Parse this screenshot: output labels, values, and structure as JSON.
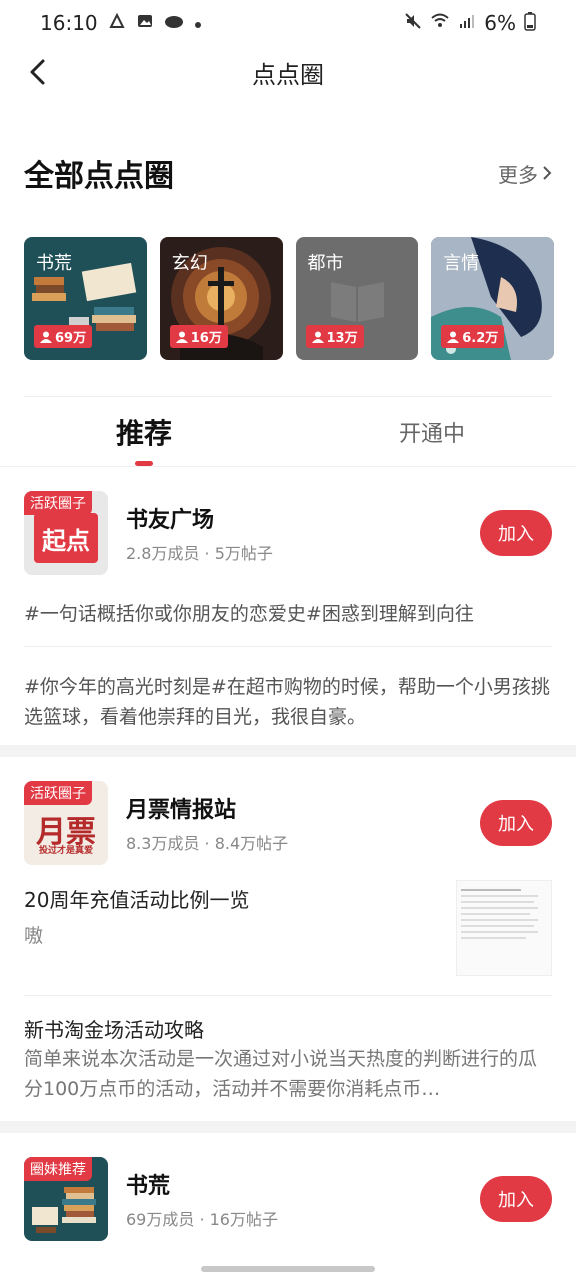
{
  "status": {
    "time": "16:10",
    "battery": "6%"
  },
  "nav": {
    "title": "点点圈"
  },
  "section": {
    "title": "全部点点圈",
    "more_label": "更多"
  },
  "categories": [
    {
      "name": "书荒",
      "members": "69万"
    },
    {
      "name": "玄幻",
      "members": "16万"
    },
    {
      "name": "都市",
      "members": "13万"
    },
    {
      "name": "言情",
      "members": "6.2万"
    }
  ],
  "tabs": [
    {
      "label": "推荐"
    },
    {
      "label": "开通中"
    }
  ],
  "circles": [
    {
      "tag": "活跃圈子",
      "avatar_text": "起点",
      "name": "书友广场",
      "stats": "2.8万成员 · 5万帖子",
      "join_label": "加入",
      "topics": [
        "#一句话概括你或你朋友的恋爱史#困惑到理解到向往",
        "#你今年的高光时刻是#在超市购物的时候，帮助一个小男孩挑选篮球，看着他崇拜的目光，我很自豪。"
      ]
    },
    {
      "tag": "活跃圈子",
      "avatar_text": "月票",
      "avatar_sub": "投过才是真爱",
      "name": "月票情报站",
      "stats": "8.3万成员 · 8.4万帖子",
      "join_label": "加入",
      "posts": [
        {
          "title": "20周年充值活动比例一览",
          "body": "嗷"
        },
        {
          "title": "新书淘金场活动攻略",
          "body": "简单来说本次活动是一次通过对小说当天热度的判断进行的瓜分100万点币的活动，活动并不需要你消耗点币…"
        }
      ]
    },
    {
      "tag": "圈妹推荐",
      "name": "书荒",
      "stats": "69万成员 · 16万帖子",
      "join_label": "加入"
    }
  ],
  "colors": {
    "accent": "#e23a45"
  }
}
